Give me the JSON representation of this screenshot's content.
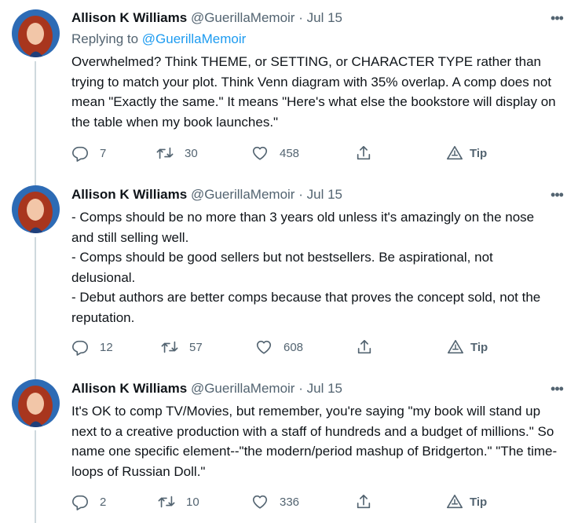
{
  "tweets": [
    {
      "name": "Allison K Williams",
      "handle": "@GuerillaMemoir",
      "separator": "·",
      "date": "Jul 15",
      "replying_label": "Replying to",
      "replying_to": "@GuerillaMemoir",
      "text": "Overwhelmed? Think THEME, or SETTING, or CHARACTER TYPE rather than trying to match your plot. Think Venn diagram with 35% overlap. A comp does not mean \"Exactly the same.\" It means \"Here's what else the bookstore will display on the table when my book launches.\"",
      "replies": "7",
      "retweets": "30",
      "likes": "458",
      "tip": "Tip"
    },
    {
      "name": "Allison K Williams",
      "handle": "@GuerillaMemoir",
      "separator": "·",
      "date": "Jul 15",
      "text": "- Comps should be no more than 3 years old unless it's amazingly on the nose and still selling well.\n- Comps should be good sellers but not bestsellers. Be aspirational, not delusional.\n- Debut authors are better comps because that proves the concept sold, not the reputation.",
      "replies": "12",
      "retweets": "57",
      "likes": "608",
      "tip": "Tip"
    },
    {
      "name": "Allison K Williams",
      "handle": "@GuerillaMemoir",
      "separator": "·",
      "date": "Jul 15",
      "text": "It's OK to comp TV/Movies, but remember, you're saying \"my book will stand up next to a creative production with a staff of hundreds and a budget of millions.\" So name one specific element--\"the modern/period mashup of Bridgerton.\" \"The time-loops of Russian Doll.\"",
      "replies": "2",
      "retweets": "10",
      "likes": "336",
      "tip": "Tip"
    }
  ],
  "colors": {
    "text": "#0f1419",
    "muted": "#536471",
    "link": "#1d9bf0",
    "thread_line": "#cfd9de"
  },
  "icons": [
    "avatar",
    "more-icon",
    "reply-icon",
    "retweet-icon",
    "like-icon",
    "share-icon",
    "tip-icon"
  ]
}
